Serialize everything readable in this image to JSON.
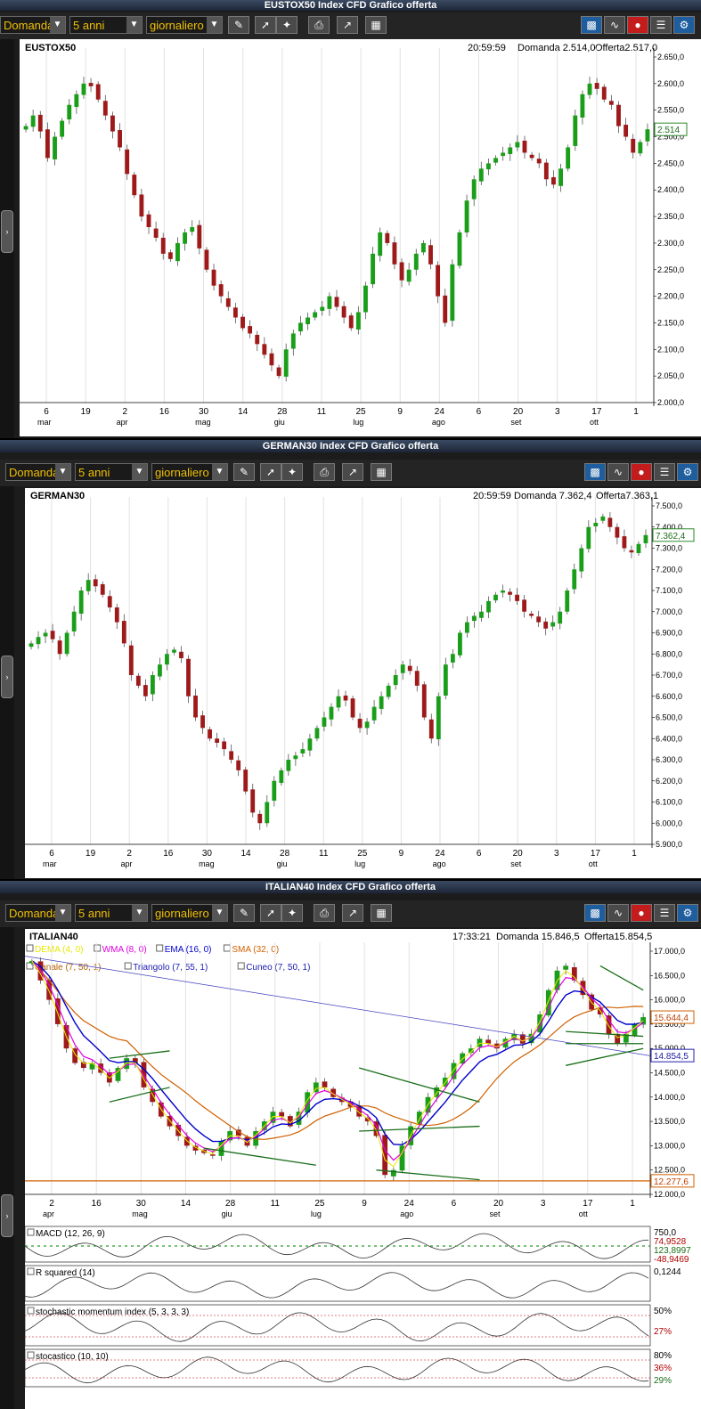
{
  "toolbar": {
    "price_type": "Domanda",
    "range": "5 anni",
    "interval": "giornaliero"
  },
  "panels": [
    {
      "title": "EUSTOX50 Index CFD Grafico offerta",
      "symbol": "EUSTOX50",
      "time": "20:59:59",
      "bid": "Domanda 2.514,0",
      "ask": "Offerta2.517,0",
      "current_label": "2.514"
    },
    {
      "title": "GERMAN30 Index CFD Grafico offerta",
      "symbol": "GERMAN30",
      "time": "20:59:59",
      "bid": "Domanda 7.362,4",
      "ask": "Offerta7.363,1",
      "current_label": "7.362,4"
    },
    {
      "title": "ITALIAN40 Index CFD Grafico offerta",
      "symbol": "ITALIAN40",
      "time": "17:33:21",
      "bid": "Domanda 15.846,5",
      "ask": "Offerta15.854,5",
      "current_label": "15.644,4"
    }
  ],
  "italian_extra": {
    "indicator_legend_row1": [
      "DEMA (4, 0)",
      "WMA (8, 0)",
      "EMA (16, 0)",
      "SMA (32, 0)"
    ],
    "indicator_legend_row2": [
      "Canale (7, 50, 1)",
      "Triangolo (7, 55, 1)",
      "Cuneo (7, 50, 1)"
    ],
    "price_labels": [
      "14.854,5",
      "12.277,6"
    ],
    "subcharts": [
      {
        "label": "MACD (12, 26, 9)",
        "values": [
          "750,0",
          "74,9528",
          "123,8997",
          "-48,9469"
        ]
      },
      {
        "label": "R squared (14)",
        "values": [
          "0,1244"
        ]
      },
      {
        "label": "stochastic momentum index (5, 3, 3, 3)",
        "values": [
          "50%",
          "27%"
        ]
      },
      {
        "label": "stocastico (10, 10)",
        "values": [
          "80%",
          "36%",
          "29%"
        ]
      }
    ]
  },
  "colors": {
    "up": "#1a9e1a",
    "down": "#9e1a1a",
    "dema": "#e8e800",
    "wma": "#e000e0",
    "ema": "#0000cc",
    "sma": "#d06000",
    "trend": "#1a6e1a"
  },
  "chart_data": [
    {
      "type": "candlestick",
      "title": "EUSTOX50",
      "ylim": [
        2000,
        2650
      ],
      "yticks": [
        "2.650,0",
        "2.600,0",
        "2.550,0",
        "2.500,0",
        "2.450,0",
        "2.400,0",
        "2.350,0",
        "2.300,0",
        "2.250,0",
        "2.200,0",
        "2.150,0",
        "2.100,0",
        "2.050,0",
        "2.000,0"
      ],
      "xticks": [
        "6",
        "19",
        "2",
        "16",
        "30",
        "14",
        "28",
        "11",
        "25",
        "9",
        "24",
        "6",
        "20",
        "3",
        "17",
        "1"
      ],
      "months": [
        "mar",
        "apr",
        "mag",
        "giu",
        "lug",
        "ago",
        "set",
        "ott"
      ],
      "closes": [
        2520,
        2540,
        2510,
        2460,
        2500,
        2530,
        2560,
        2580,
        2600,
        2595,
        2570,
        2540,
        2510,
        2480,
        2430,
        2390,
        2350,
        2330,
        2310,
        2280,
        2270,
        2300,
        2320,
        2330,
        2290,
        2250,
        2220,
        2200,
        2180,
        2160,
        2140,
        2130,
        2110,
        2090,
        2070,
        2050,
        2100,
        2130,
        2150,
        2160,
        2170,
        2180,
        2200,
        2180,
        2160,
        2140,
        2170,
        2220,
        2280,
        2320,
        2300,
        2260,
        2230,
        2250,
        2280,
        2300,
        2260,
        2200,
        2150,
        2260,
        2320,
        2380,
        2420,
        2440,
        2450,
        2460,
        2470,
        2480,
        2490,
        2470,
        2460,
        2450,
        2420,
        2410,
        2440,
        2480,
        2540,
        2580,
        2600,
        2590,
        2570,
        2560,
        2520,
        2500,
        2470,
        2490,
        2514
      ]
    },
    {
      "type": "candlestick",
      "title": "GERMAN30",
      "ylim": [
        5900,
        7500
      ],
      "yticks": [
        "7.500,0",
        "7.400,0",
        "7.300,0",
        "7.200,0",
        "7.100,0",
        "7.000,0",
        "6.900,0",
        "6.800,0",
        "6.700,0",
        "6.600,0",
        "6.500,0",
        "6.400,0",
        "6.300,0",
        "6.200,0",
        "6.100,0",
        "6.000,0",
        "5.900,0"
      ],
      "xticks": [
        "6",
        "19",
        "2",
        "16",
        "30",
        "14",
        "28",
        "11",
        "25",
        "9",
        "24",
        "6",
        "20",
        "3",
        "17",
        "1"
      ],
      "months": [
        "mar",
        "apr",
        "mag",
        "giu",
        "lug",
        "ago",
        "set",
        "ott"
      ],
      "closes": [
        6850,
        6880,
        6900,
        6870,
        6800,
        6900,
        7000,
        7100,
        7150,
        7120,
        7080,
        7020,
        6950,
        6850,
        6700,
        6650,
        6600,
        6700,
        6750,
        6800,
        6820,
        6780,
        6600,
        6500,
        6450,
        6400,
        6380,
        6350,
        6300,
        6250,
        6150,
        6050,
        6000,
        6100,
        6200,
        6250,
        6300,
        6320,
        6350,
        6400,
        6450,
        6500,
        6550,
        6600,
        6580,
        6500,
        6450,
        6480,
        6550,
        6600,
        6650,
        6700,
        6750,
        6720,
        6650,
        6500,
        6400,
        6600,
        6750,
        6800,
        6900,
        6950,
        6980,
        7000,
        7050,
        7080,
        7100,
        7080,
        7050,
        7000,
        6980,
        6950,
        6920,
        6950,
        7000,
        7100,
        7200,
        7300,
        7400,
        7420,
        7450,
        7400,
        7350,
        7300,
        7280,
        7320,
        7362
      ]
    },
    {
      "type": "candlestick",
      "title": "ITALIAN40",
      "ylim": [
        12000,
        17000
      ],
      "yticks": [
        "17.000,0",
        "16.500,0",
        "16.000,0",
        "15.500,0",
        "15.000,0",
        "14.500,0",
        "14.000,0",
        "13.500,0",
        "13.000,0",
        "12.500,0",
        "12.000,0"
      ],
      "xticks": [
        "2",
        "16",
        "30",
        "14",
        "28",
        "11",
        "25",
        "9",
        "24",
        "6",
        "20",
        "3",
        "17",
        "1"
      ],
      "months": [
        "apr",
        "mag",
        "giu",
        "lug",
        "ago",
        "set",
        "ott"
      ],
      "closes": [
        16800,
        16400,
        16000,
        15500,
        15000,
        14700,
        14600,
        14700,
        14500,
        14300,
        14600,
        14800,
        14700,
        14200,
        13900,
        13600,
        13400,
        13200,
        13000,
        12900,
        12850,
        12800,
        13100,
        13300,
        13200,
        13000,
        13300,
        13500,
        13700,
        13600,
        13400,
        13700,
        14100,
        14300,
        14200,
        14000,
        13900,
        13800,
        13600,
        13500,
        13200,
        12400,
        12500,
        13000,
        13400,
        13700,
        14000,
        14200,
        14400,
        14700,
        14900,
        15000,
        15200,
        15100,
        15000,
        15200,
        15300,
        15100,
        15300,
        15700,
        16200,
        16600,
        16700,
        16400,
        16100,
        15800,
        15700,
        15300,
        15100,
        15300,
        15500,
        15644
      ]
    }
  ]
}
